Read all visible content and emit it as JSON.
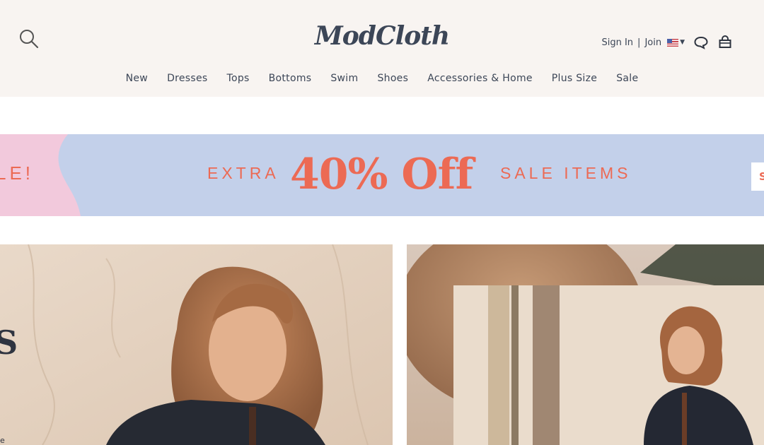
{
  "header": {
    "logo": "ModCloth",
    "sign_in": "Sign In",
    "separator": "|",
    "join": "Join"
  },
  "nav": {
    "items": [
      "New",
      "Dresses",
      "Tops",
      "Bottoms",
      "Swim",
      "Shoes",
      "Accessories & Home",
      "Plus Size",
      "Sale"
    ]
  },
  "banner": {
    "left_text": "LE!",
    "extra": "EXTRA",
    "headline": "40% Off",
    "items": "SALE ITEMS",
    "button": "S",
    "colors": {
      "background": "#c3d0ea",
      "accent": "#ec6a54",
      "pink": "#f2c9dc"
    }
  },
  "hero": {
    "left_letter": "S",
    "left_caption": "e"
  },
  "icons": [
    "search-icon",
    "us-flag-icon",
    "chevron-down-icon",
    "chat-icon",
    "bag-icon"
  ]
}
